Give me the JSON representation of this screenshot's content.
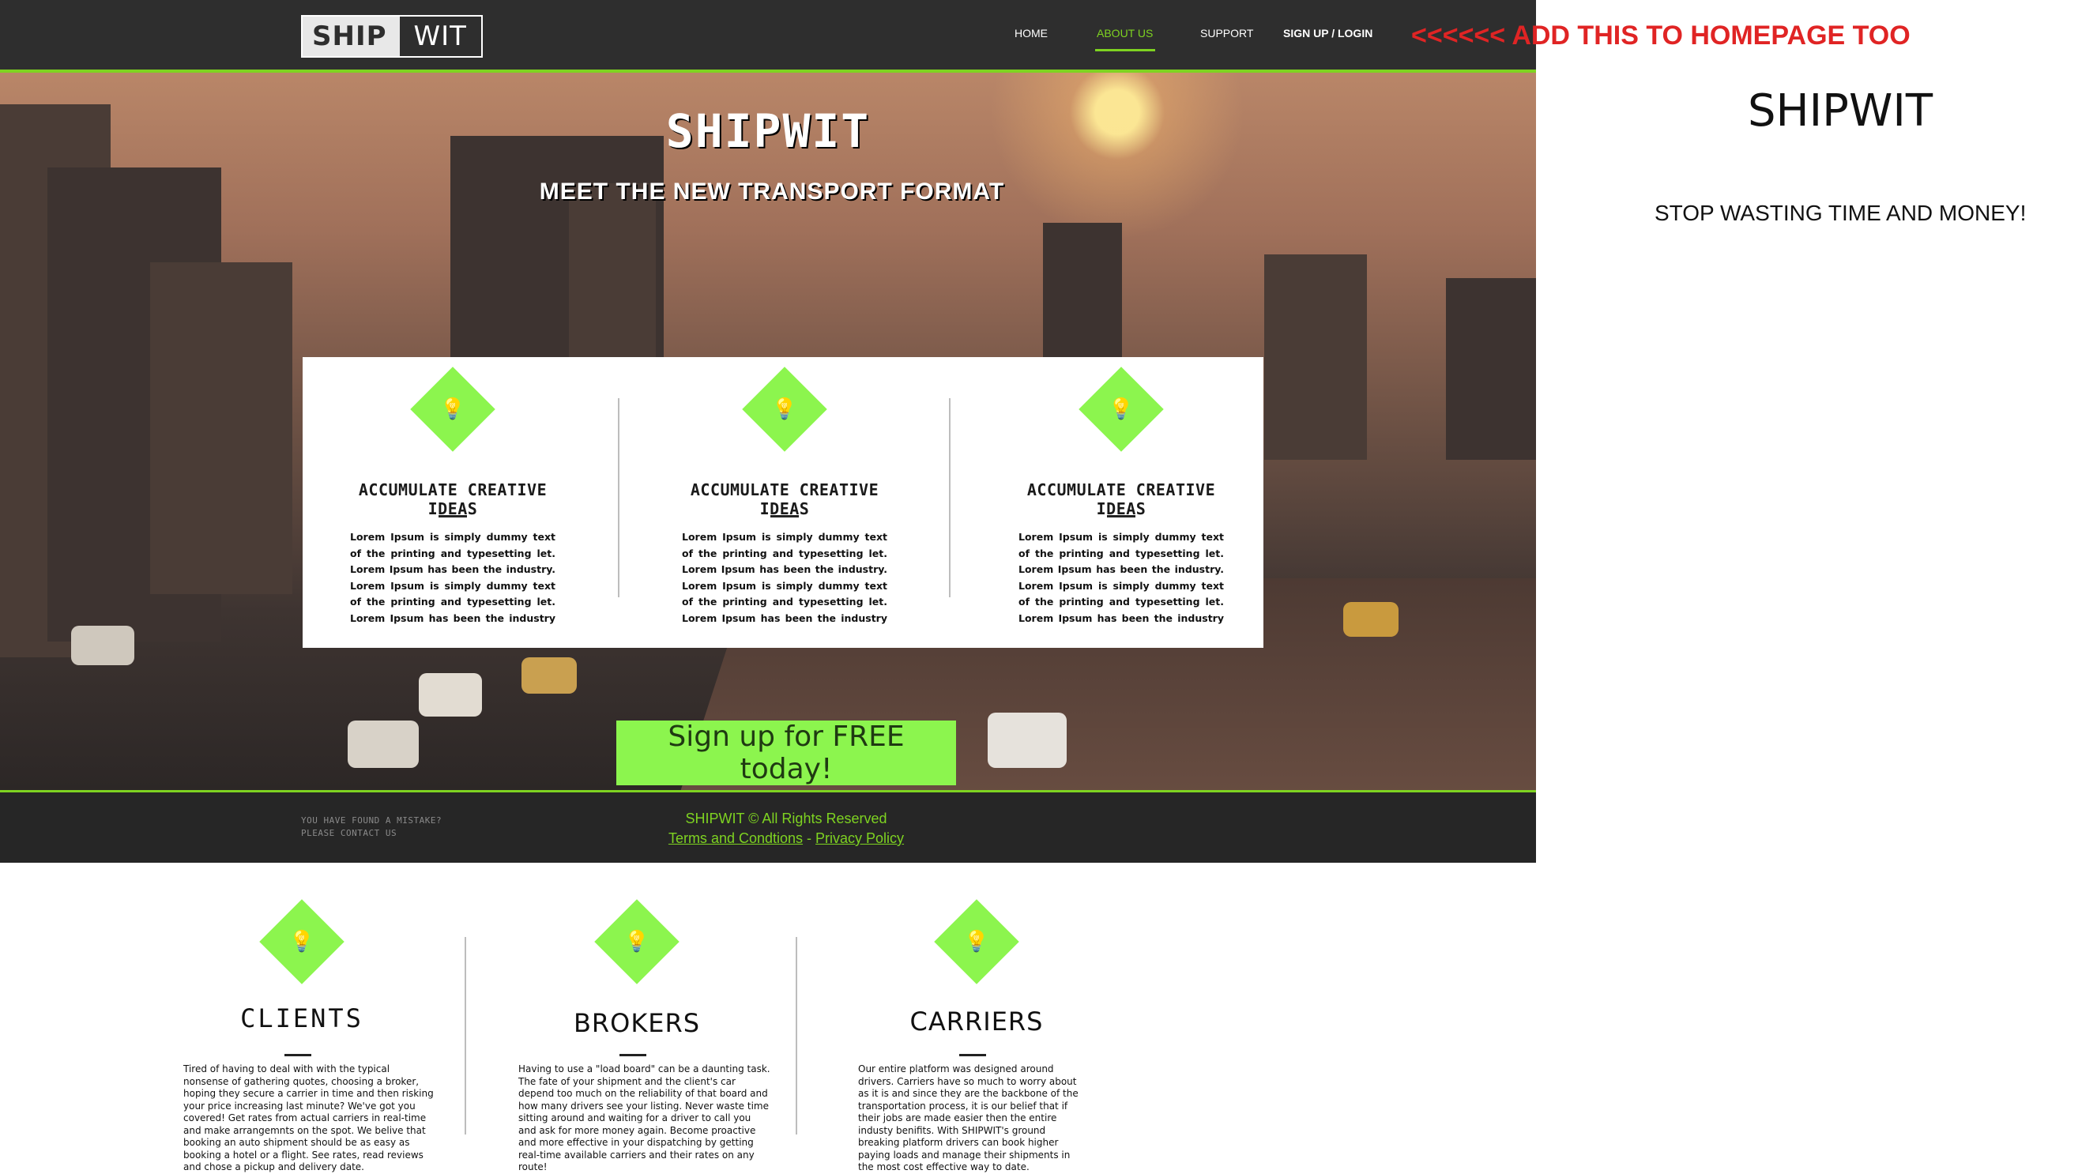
{
  "nav": {
    "logo_left": "SHIP",
    "logo_right": "WIT",
    "links": [
      "HOME",
      "ABOUT US",
      "SUPPORT",
      "SIGN UP / LOGIN"
    ]
  },
  "annotation": "<<<<<< ADD THIS TO HOMEPAGE TOO",
  "hero": {
    "title": "SHIPWIT",
    "subtitle": "MEET THE NEW TRANSPORT FORMAT",
    "cta": "Sign up for FREE today!"
  },
  "features": [
    {
      "title": "ACCUMULATE CREATIVE IDEAS",
      "text": "Lorem Ipsum is simply dummy text of the printing and typesetting let. Lorem Ipsum has been the industry. Lorem Ipsum is simply dummy text of the printing and typesetting let. Lorem Ipsum has been the industry Printing and"
    },
    {
      "title": "ACCUMULATE CREATIVE IDEAS",
      "text": "Lorem Ipsum is simply dummy text of the printing and typesetting let. Lorem Ipsum has been the industry. Lorem Ipsum is simply dummy text of the printing and typesetting let. Lorem Ipsum has been the industry Printing and"
    },
    {
      "title": "ACCUMULATE CREATIVE IDEAS",
      "text": "Lorem Ipsum is simply dummy text of the printing and typesetting let. Lorem Ipsum has been the industry. Lorem Ipsum is simply dummy text of the printing and typesetting let. Lorem Ipsum has been the industry Printing and"
    }
  ],
  "footer": {
    "mistake_line1": "YOU HAVE FOUND A MISTAKE?",
    "mistake_line2": "PLEASE CONTACT US",
    "copyright": "SHIPWIT © All Rights Reserved",
    "terms": "Terms and Condtions",
    "separator": " - ",
    "privacy": "Privacy Policy"
  },
  "side": {
    "title": "SHIPWIT",
    "subtitle": "STOP WASTING TIME AND MONEY!"
  },
  "lower": [
    {
      "title": "CLIENTS",
      "text": "Tired of having to deal with with the typical nonsense of gathering quotes, choosing a broker, hoping they secure a carrier in time and then risking your price increasing last minute? We've got you covered! Get rates from actual carriers in real-time and make arrangemnts on the spot. We belive that booking an auto shipment should be as easy as booking a hotel or a flight. See rates, read reviews and chose a pickup and delivery date."
    },
    {
      "title": "BROKERS",
      "text": "Having to use a \"load board\" can be a daunting task. The fate of your shipment and the client's car depend too much on the reliability of that board and how many drivers see your listing. Never waste time sitting around and waiting for a driver to call you and ask for more money again. Become proactive and more effective in your dispatching by getting real-time available carriers and their rates on any route!"
    },
    {
      "title": "CARRIERS",
      "text": "Our entire platform was designed around drivers. Carriers have so much to worry about as it is and since they are the backbone of the transportation process, it is our belief that if their jobs are made easier then the entire industy benifits. With SHIPWIT's ground breaking platform drivers can book higher paying loads and manage their shipments in the most cost effective way to date."
    }
  ],
  "colors": {
    "accent": "#7ed321",
    "diamond": "#8cf54e",
    "dark": "#2e2e2e",
    "annotation": "#e02424"
  }
}
